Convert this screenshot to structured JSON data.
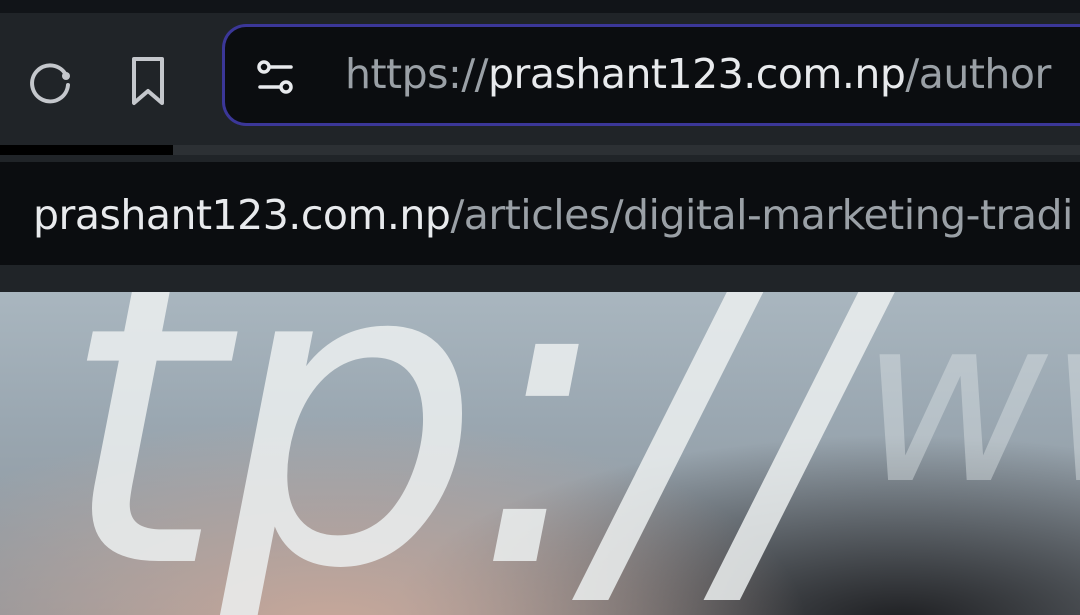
{
  "toolbar": {
    "reload_icon": "reload-icon",
    "bookmark_icon": "bookmark-icon",
    "site_settings_icon": "tune-icon",
    "url_scheme": "https://",
    "url_host": "prashant123.com.np",
    "url_path": "/author"
  },
  "progress": {
    "fraction": 0.16
  },
  "suggestion": {
    "host": "prashant123.com.np",
    "path": "/articles/digital-marketing-tradi"
  },
  "hero": {
    "big_text": "tp://",
    "small_text": "ww"
  },
  "colors": {
    "address_border": "#3b3798",
    "background": "#202428",
    "field": "#0b0d10"
  }
}
